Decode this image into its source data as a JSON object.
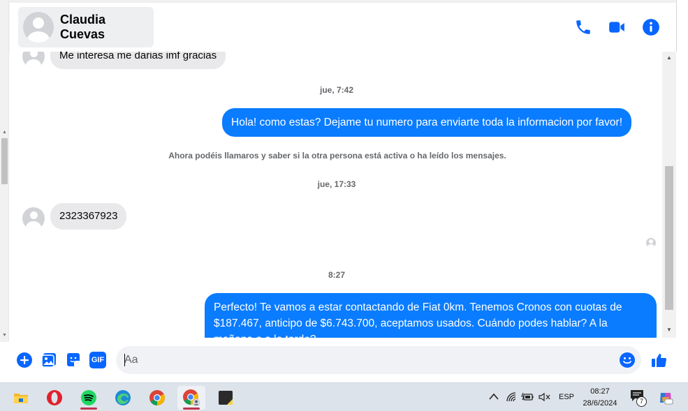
{
  "header": {
    "contact_name": "Claudia Cuevas",
    "actions": [
      "phone-icon",
      "video-call-icon",
      "info-icon"
    ]
  },
  "messages": [
    {
      "type": "incoming",
      "text": "Me interesa me darias imf gracias"
    },
    {
      "type": "timestamp",
      "text": "jue, 7:42"
    },
    {
      "type": "outgoing",
      "text": "Hola! como estas? Dejame tu numero para enviarte toda la informacion por favor!"
    },
    {
      "type": "system",
      "text": "Ahora podéis llamaros y saber si la otra persona está activa o ha leído los mensajes."
    },
    {
      "type": "timestamp",
      "text": "jue, 17:33"
    },
    {
      "type": "incoming",
      "text": "2323367923"
    },
    {
      "type": "timestamp",
      "text": "8:27"
    },
    {
      "type": "outgoing",
      "text": "Perfecto! Te vamos a estar contactando de Fiat 0km. Tenemos Cronos con cuotas de $187.467, anticipo de $6.743.700, aceptamos usados. Cuándo podes hablar? A la mañana o a la tarde?"
    }
  ],
  "composer": {
    "placeholder": "Aa",
    "icons": [
      "add-icon",
      "image-icon",
      "sticker-icon",
      "gif-icon",
      "emoji-icon",
      "thumbs-up-icon"
    ],
    "gif_label": "GIF"
  },
  "taskbar": {
    "apps": [
      "file-explorer-icon",
      "opera-icon",
      "spotify-icon",
      "edge-icon",
      "chrome-icon",
      "chrome-profile-icon",
      "sticky-notes-icon"
    ],
    "language": "ESP",
    "time": "08:27",
    "date": "28/6/2024",
    "notification_count": "7"
  },
  "colors": {
    "accent": "#0a7cff",
    "icon_blue": "#0866ff",
    "incoming_bubble": "#e9e9eb",
    "taskbar": "#dde3ea"
  }
}
